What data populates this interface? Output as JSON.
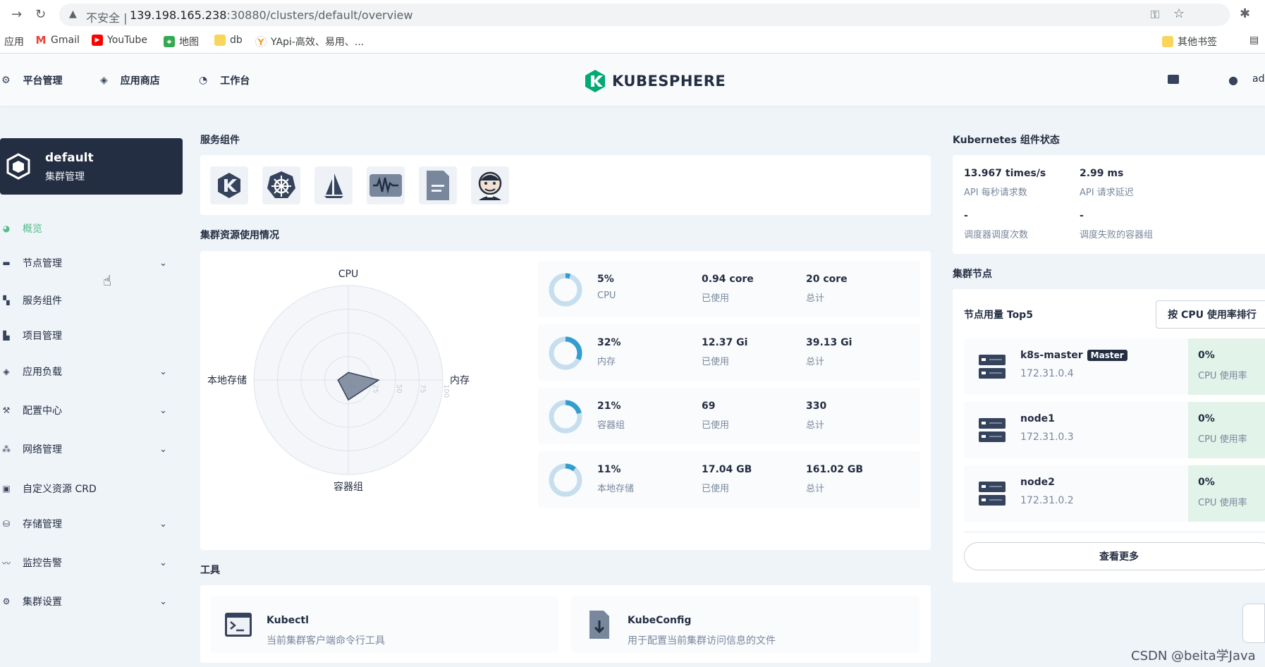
{
  "browser": {
    "insecure_label": "不安全",
    "url_host": "139.198.165.238",
    "url_rest": ":30880/clusters/default/overview",
    "bookmarks": [
      "应用",
      "Gmail",
      "YouTube",
      "地图",
      "db",
      "YApi-高效、易用、..."
    ],
    "other_bookmarks": "其他书签"
  },
  "header": {
    "nav": [
      "平台管理",
      "应用商店",
      "工作台"
    ],
    "logo_text": "KUBESPHERE",
    "user": "ad"
  },
  "cluster": {
    "name": "default",
    "subtitle": "集群管理"
  },
  "sidebar": {
    "items": [
      {
        "label": "概览",
        "icon": "dashboard-icon",
        "active": true,
        "expandable": false
      },
      {
        "label": "节点管理",
        "icon": "nodes-icon",
        "active": false,
        "expandable": true
      },
      {
        "label": "服务组件",
        "icon": "components-icon",
        "active": false,
        "expandable": false
      },
      {
        "label": "项目管理",
        "icon": "project-icon",
        "active": false,
        "expandable": false
      },
      {
        "label": "应用负载",
        "icon": "appcluster-icon",
        "active": false,
        "expandable": true
      },
      {
        "label": "配置中心",
        "icon": "hammer-icon",
        "active": false,
        "expandable": true
      },
      {
        "label": "网络管理",
        "icon": "network-icon",
        "active": false,
        "expandable": true
      },
      {
        "label": "自定义资源 CRD",
        "icon": "crd-icon",
        "active": false,
        "expandable": false
      },
      {
        "label": "存储管理",
        "icon": "storage-icon",
        "active": false,
        "expandable": true
      },
      {
        "label": "监控告警",
        "icon": "monitor-icon",
        "active": false,
        "expandable": true
      },
      {
        "label": "集群设置",
        "icon": "cogwheel-icon",
        "active": false,
        "expandable": true
      }
    ]
  },
  "services": {
    "title": "服务组件",
    "icons": [
      "kubesphere-icon",
      "kubernetes-icon",
      "istio-icon",
      "monitoring-icon",
      "logging-icon",
      "jenkins-icon"
    ]
  },
  "resources": {
    "title": "集群资源使用情况",
    "metrics": [
      {
        "pct": "5%",
        "name": "CPU",
        "used": "0.94 core",
        "used_label": "已使用",
        "total": "20 core",
        "total_label": "总计",
        "ratio": 0.05
      },
      {
        "pct": "32%",
        "name": "内存",
        "used": "12.37 Gi",
        "used_label": "已使用",
        "total": "39.13 Gi",
        "total_label": "总计",
        "ratio": 0.32
      },
      {
        "pct": "21%",
        "name": "容器组",
        "used": "69",
        "used_label": "已使用",
        "total": "330",
        "total_label": "总计",
        "ratio": 0.21
      },
      {
        "pct": "11%",
        "name": "本地存储",
        "used": "17.04 GB",
        "used_label": "已使用",
        "total": "161.02 GB",
        "total_label": "总计",
        "ratio": 0.11
      }
    ]
  },
  "chart_data": {
    "type": "radar",
    "axes": [
      "CPU",
      "内存",
      "容器组",
      "本地存储"
    ],
    "values": [
      5,
      32,
      21,
      11
    ],
    "ticks": [
      "0",
      "25",
      "50",
      "75",
      "100"
    ],
    "range": [
      0,
      100
    ],
    "grid": true
  },
  "tools": {
    "title": "工具",
    "items": [
      {
        "name": "Kubectl",
        "desc": "当前集群客户端命令行工具"
      },
      {
        "name": "KubeConfig",
        "desc": "用于配置当前集群访问信息的文件"
      }
    ]
  },
  "k8s": {
    "title": "Kubernetes 组件状态",
    "stats": [
      {
        "value": "13.967 times/s",
        "label": "API 每秒请求数"
      },
      {
        "value": "2.99 ms",
        "label": "API 请求延迟"
      },
      {
        "value": "-",
        "label": "调度器调度次数"
      },
      {
        "value": "-",
        "label": "调度失败的容器组"
      }
    ]
  },
  "nodes": {
    "title": "集群节点",
    "subtitle": "节点用量 Top5",
    "sort_button": "按 CPU 使用率排行",
    "items": [
      {
        "name": "k8s-master",
        "role": "Master",
        "ip": "172.31.0.4",
        "pct": "0%",
        "pct_label": "CPU 使用率"
      },
      {
        "name": "node1",
        "role": "",
        "ip": "172.31.0.3",
        "pct": "0%",
        "pct_label": "CPU 使用率"
      },
      {
        "name": "node2",
        "role": "",
        "ip": "172.31.0.2",
        "pct": "0%",
        "pct_label": "CPU 使用率"
      }
    ],
    "more_button": "查看更多"
  },
  "watermark": "CSDN @beita学Java",
  "colors": {
    "accent": "#55bc8a",
    "dark": "#242e42",
    "ring": "#329dce",
    "ring_bg": "#c7deef"
  }
}
